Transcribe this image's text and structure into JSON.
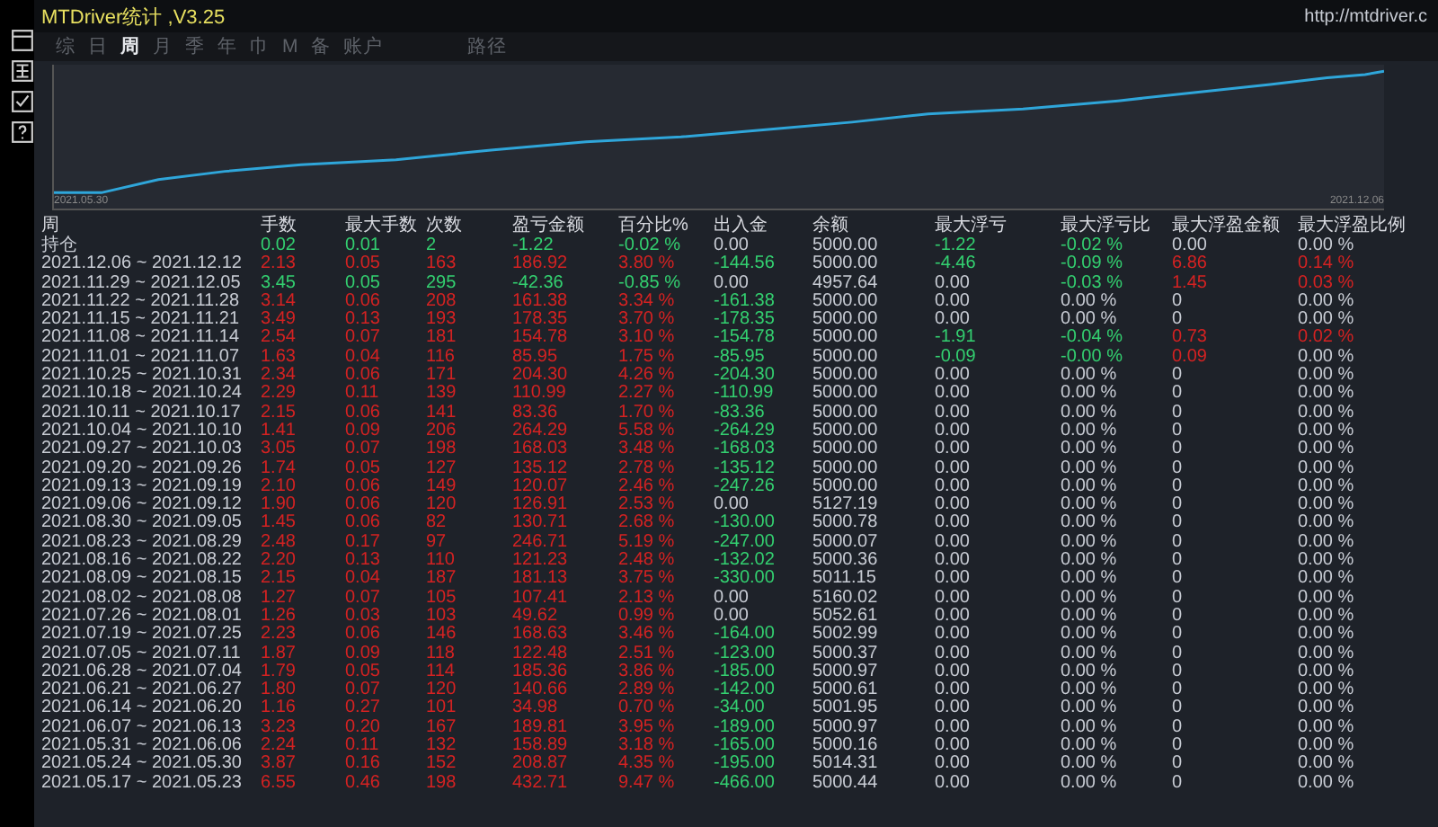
{
  "window": {
    "title": "MTDriver统计 ,V3.25",
    "url": "http://mtdriver.c"
  },
  "tabs": [
    {
      "label": "综",
      "selected": false
    },
    {
      "label": "日",
      "selected": false
    },
    {
      "label": "周",
      "selected": true
    },
    {
      "label": "月",
      "selected": false
    },
    {
      "label": "季",
      "selected": false
    },
    {
      "label": "年",
      "selected": false
    },
    {
      "label": "巾",
      "selected": false
    },
    {
      "label": "M",
      "selected": false
    },
    {
      "label": "备",
      "selected": false
    },
    {
      "label": "账户",
      "selected": false
    },
    {
      "label": "路径",
      "selected": false
    }
  ],
  "chart": {
    "start_label": "2021.05.30",
    "end_label": "2021.12.06"
  },
  "table": {
    "columns": [
      "周",
      "手数",
      "最大手数",
      "次数",
      "盈亏金额",
      "百分比%",
      "出入金",
      "余额",
      "最大浮亏",
      "最大浮亏比",
      "最大浮盈金额",
      "最大浮盈比例"
    ],
    "rows": [
      {
        "cells": [
          {
            "text": "持仓",
            "color": "#c8ccd4"
          },
          {
            "text": "0.02",
            "color": "#33d070"
          },
          {
            "text": "0.01",
            "color": "#33d070"
          },
          {
            "text": "2",
            "color": "#33d070"
          },
          {
            "text": "-1.22",
            "color": "#33d070"
          },
          {
            "text": "-0.02 %",
            "color": "#33d070"
          },
          {
            "text": "0.00",
            "color": "#c8ccd4"
          },
          {
            "text": "5000.00",
            "color": "#c8ccd4"
          },
          {
            "text": "-1.22",
            "color": "#33d070"
          },
          {
            "text": "-0.02 %",
            "color": "#33d070"
          },
          {
            "text": "0.00",
            "color": "#c8ccd4"
          },
          {
            "text": "0.00 %",
            "color": "#c8ccd4"
          }
        ]
      },
      {
        "cells": [
          {
            "text": "2021.12.06 ~ 2021.12.12",
            "color": "#c8ccd4"
          },
          {
            "text": "2.13",
            "color": "#d42222"
          },
          {
            "text": "0.05",
            "color": "#d42222"
          },
          {
            "text": "163",
            "color": "#d42222"
          },
          {
            "text": "186.92",
            "color": "#d42222"
          },
          {
            "text": "3.80 %",
            "color": "#d42222"
          },
          {
            "text": "-144.56",
            "color": "#33d070"
          },
          {
            "text": "5000.00",
            "color": "#c8ccd4"
          },
          {
            "text": "-4.46",
            "color": "#33d070"
          },
          {
            "text": "-0.09 %",
            "color": "#33d070"
          },
          {
            "text": "6.86",
            "color": "#d42222"
          },
          {
            "text": "0.14 %",
            "color": "#d42222"
          }
        ]
      },
      {
        "cells": [
          {
            "text": "2021.11.29 ~ 2021.12.05",
            "color": "#c8ccd4"
          },
          {
            "text": "3.45",
            "color": "#33d070"
          },
          {
            "text": "0.05",
            "color": "#33d070"
          },
          {
            "text": "295",
            "color": "#33d070"
          },
          {
            "text": "-42.36",
            "color": "#33d070"
          },
          {
            "text": "-0.85 %",
            "color": "#33d070"
          },
          {
            "text": "0.00",
            "color": "#c8ccd4"
          },
          {
            "text": "4957.64",
            "color": "#c8ccd4"
          },
          {
            "text": "0.00",
            "color": "#c8ccd4"
          },
          {
            "text": "-0.03 %",
            "color": "#33d070"
          },
          {
            "text": "1.45",
            "color": "#d42222"
          },
          {
            "text": "0.03 %",
            "color": "#d42222"
          }
        ]
      },
      {
        "cells": [
          {
            "text": "2021.11.22 ~ 2021.11.28",
            "color": "#c8ccd4"
          },
          {
            "text": "3.14",
            "color": "#d42222"
          },
          {
            "text": "0.06",
            "color": "#d42222"
          },
          {
            "text": "208",
            "color": "#d42222"
          },
          {
            "text": "161.38",
            "color": "#d42222"
          },
          {
            "text": "3.34 %",
            "color": "#d42222"
          },
          {
            "text": "-161.38",
            "color": "#33d070"
          },
          {
            "text": "5000.00",
            "color": "#c8ccd4"
          },
          {
            "text": "0.00",
            "color": "#c8ccd4"
          },
          {
            "text": "0.00 %",
            "color": "#c8ccd4"
          },
          {
            "text": "0",
            "color": "#c8ccd4"
          },
          {
            "text": "0.00 %",
            "color": "#c8ccd4"
          }
        ]
      },
      {
        "cells": [
          {
            "text": "2021.11.15 ~ 2021.11.21",
            "color": "#c8ccd4"
          },
          {
            "text": "3.49",
            "color": "#d42222"
          },
          {
            "text": "0.13",
            "color": "#d42222"
          },
          {
            "text": "193",
            "color": "#d42222"
          },
          {
            "text": "178.35",
            "color": "#d42222"
          },
          {
            "text": "3.70 %",
            "color": "#d42222"
          },
          {
            "text": "-178.35",
            "color": "#33d070"
          },
          {
            "text": "5000.00",
            "color": "#c8ccd4"
          },
          {
            "text": "0.00",
            "color": "#c8ccd4"
          },
          {
            "text": "0.00 %",
            "color": "#c8ccd4"
          },
          {
            "text": "0",
            "color": "#c8ccd4"
          },
          {
            "text": "0.00 %",
            "color": "#c8ccd4"
          }
        ]
      },
      {
        "cells": [
          {
            "text": "2021.11.08 ~ 2021.11.14",
            "color": "#c8ccd4"
          },
          {
            "text": "2.54",
            "color": "#d42222"
          },
          {
            "text": "0.07",
            "color": "#d42222"
          },
          {
            "text": "181",
            "color": "#d42222"
          },
          {
            "text": "154.78",
            "color": "#d42222"
          },
          {
            "text": "3.10 %",
            "color": "#d42222"
          },
          {
            "text": "-154.78",
            "color": "#33d070"
          },
          {
            "text": "5000.00",
            "color": "#c8ccd4"
          },
          {
            "text": "-1.91",
            "color": "#33d070"
          },
          {
            "text": "-0.04 %",
            "color": "#33d070"
          },
          {
            "text": "0.73",
            "color": "#d42222"
          },
          {
            "text": "0.02 %",
            "color": "#d42222"
          }
        ]
      },
      {
        "cells": [
          {
            "text": "2021.11.01 ~ 2021.11.07",
            "color": "#c8ccd4"
          },
          {
            "text": "1.63",
            "color": "#d42222"
          },
          {
            "text": "0.04",
            "color": "#d42222"
          },
          {
            "text": "116",
            "color": "#d42222"
          },
          {
            "text": "85.95",
            "color": "#d42222"
          },
          {
            "text": "1.75 %",
            "color": "#d42222"
          },
          {
            "text": "-85.95",
            "color": "#33d070"
          },
          {
            "text": "5000.00",
            "color": "#c8ccd4"
          },
          {
            "text": "-0.09",
            "color": "#33d070"
          },
          {
            "text": "-0.00 %",
            "color": "#33d070"
          },
          {
            "text": "0.09",
            "color": "#d42222"
          },
          {
            "text": "0.00 %",
            "color": "#c8ccd4"
          }
        ]
      },
      {
        "cells": [
          {
            "text": "2021.10.25 ~ 2021.10.31",
            "color": "#c8ccd4"
          },
          {
            "text": "2.34",
            "color": "#d42222"
          },
          {
            "text": "0.06",
            "color": "#d42222"
          },
          {
            "text": "171",
            "color": "#d42222"
          },
          {
            "text": "204.30",
            "color": "#d42222"
          },
          {
            "text": "4.26 %",
            "color": "#d42222"
          },
          {
            "text": "-204.30",
            "color": "#33d070"
          },
          {
            "text": "5000.00",
            "color": "#c8ccd4"
          },
          {
            "text": "0.00",
            "color": "#c8ccd4"
          },
          {
            "text": "0.00 %",
            "color": "#c8ccd4"
          },
          {
            "text": "0",
            "color": "#c8ccd4"
          },
          {
            "text": "0.00 %",
            "color": "#c8ccd4"
          }
        ]
      },
      {
        "cells": [
          {
            "text": "2021.10.18 ~ 2021.10.24",
            "color": "#c8ccd4"
          },
          {
            "text": "2.29",
            "color": "#d42222"
          },
          {
            "text": "0.11",
            "color": "#d42222"
          },
          {
            "text": "139",
            "color": "#d42222"
          },
          {
            "text": "110.99",
            "color": "#d42222"
          },
          {
            "text": "2.27 %",
            "color": "#d42222"
          },
          {
            "text": "-110.99",
            "color": "#33d070"
          },
          {
            "text": "5000.00",
            "color": "#c8ccd4"
          },
          {
            "text": "0.00",
            "color": "#c8ccd4"
          },
          {
            "text": "0.00 %",
            "color": "#c8ccd4"
          },
          {
            "text": "0",
            "color": "#c8ccd4"
          },
          {
            "text": "0.00 %",
            "color": "#c8ccd4"
          }
        ]
      },
      {
        "cells": [
          {
            "text": "2021.10.11 ~ 2021.10.17",
            "color": "#c8ccd4"
          },
          {
            "text": "2.15",
            "color": "#d42222"
          },
          {
            "text": "0.06",
            "color": "#d42222"
          },
          {
            "text": "141",
            "color": "#d42222"
          },
          {
            "text": "83.36",
            "color": "#d42222"
          },
          {
            "text": "1.70 %",
            "color": "#d42222"
          },
          {
            "text": "-83.36",
            "color": "#33d070"
          },
          {
            "text": "5000.00",
            "color": "#c8ccd4"
          },
          {
            "text": "0.00",
            "color": "#c8ccd4"
          },
          {
            "text": "0.00 %",
            "color": "#c8ccd4"
          },
          {
            "text": "0",
            "color": "#c8ccd4"
          },
          {
            "text": "0.00 %",
            "color": "#c8ccd4"
          }
        ]
      },
      {
        "cells": [
          {
            "text": "2021.10.04 ~ 2021.10.10",
            "color": "#c8ccd4"
          },
          {
            "text": "1.41",
            "color": "#d42222"
          },
          {
            "text": "0.09",
            "color": "#d42222"
          },
          {
            "text": "206",
            "color": "#d42222"
          },
          {
            "text": "264.29",
            "color": "#d42222"
          },
          {
            "text": "5.58 %",
            "color": "#d42222"
          },
          {
            "text": "-264.29",
            "color": "#33d070"
          },
          {
            "text": "5000.00",
            "color": "#c8ccd4"
          },
          {
            "text": "0.00",
            "color": "#c8ccd4"
          },
          {
            "text": "0.00 %",
            "color": "#c8ccd4"
          },
          {
            "text": "0",
            "color": "#c8ccd4"
          },
          {
            "text": "0.00 %",
            "color": "#c8ccd4"
          }
        ]
      },
      {
        "cells": [
          {
            "text": "2021.09.27 ~ 2021.10.03",
            "color": "#c8ccd4"
          },
          {
            "text": "3.05",
            "color": "#d42222"
          },
          {
            "text": "0.07",
            "color": "#d42222"
          },
          {
            "text": "198",
            "color": "#d42222"
          },
          {
            "text": "168.03",
            "color": "#d42222"
          },
          {
            "text": "3.48 %",
            "color": "#d42222"
          },
          {
            "text": "-168.03",
            "color": "#33d070"
          },
          {
            "text": "5000.00",
            "color": "#c8ccd4"
          },
          {
            "text": "0.00",
            "color": "#c8ccd4"
          },
          {
            "text": "0.00 %",
            "color": "#c8ccd4"
          },
          {
            "text": "0",
            "color": "#c8ccd4"
          },
          {
            "text": "0.00 %",
            "color": "#c8ccd4"
          }
        ]
      },
      {
        "cells": [
          {
            "text": "2021.09.20 ~ 2021.09.26",
            "color": "#c8ccd4"
          },
          {
            "text": "1.74",
            "color": "#d42222"
          },
          {
            "text": "0.05",
            "color": "#d42222"
          },
          {
            "text": "127",
            "color": "#d42222"
          },
          {
            "text": "135.12",
            "color": "#d42222"
          },
          {
            "text": "2.78 %",
            "color": "#d42222"
          },
          {
            "text": "-135.12",
            "color": "#33d070"
          },
          {
            "text": "5000.00",
            "color": "#c8ccd4"
          },
          {
            "text": "0.00",
            "color": "#c8ccd4"
          },
          {
            "text": "0.00 %",
            "color": "#c8ccd4"
          },
          {
            "text": "0",
            "color": "#c8ccd4"
          },
          {
            "text": "0.00 %",
            "color": "#c8ccd4"
          }
        ]
      },
      {
        "cells": [
          {
            "text": "2021.09.13 ~ 2021.09.19",
            "color": "#c8ccd4"
          },
          {
            "text": "2.10",
            "color": "#d42222"
          },
          {
            "text": "0.06",
            "color": "#d42222"
          },
          {
            "text": "149",
            "color": "#d42222"
          },
          {
            "text": "120.07",
            "color": "#d42222"
          },
          {
            "text": "2.46 %",
            "color": "#d42222"
          },
          {
            "text": "-247.26",
            "color": "#33d070"
          },
          {
            "text": "5000.00",
            "color": "#c8ccd4"
          },
          {
            "text": "0.00",
            "color": "#c8ccd4"
          },
          {
            "text": "0.00 %",
            "color": "#c8ccd4"
          },
          {
            "text": "0",
            "color": "#c8ccd4"
          },
          {
            "text": "0.00 %",
            "color": "#c8ccd4"
          }
        ]
      },
      {
        "cells": [
          {
            "text": "2021.09.06 ~ 2021.09.12",
            "color": "#c8ccd4"
          },
          {
            "text": "1.90",
            "color": "#d42222"
          },
          {
            "text": "0.06",
            "color": "#d42222"
          },
          {
            "text": "120",
            "color": "#d42222"
          },
          {
            "text": "126.91",
            "color": "#d42222"
          },
          {
            "text": "2.53 %",
            "color": "#d42222"
          },
          {
            "text": "0.00",
            "color": "#c8ccd4"
          },
          {
            "text": "5127.19",
            "color": "#c8ccd4"
          },
          {
            "text": "0.00",
            "color": "#c8ccd4"
          },
          {
            "text": "0.00 %",
            "color": "#c8ccd4"
          },
          {
            "text": "0",
            "color": "#c8ccd4"
          },
          {
            "text": "0.00 %",
            "color": "#c8ccd4"
          }
        ]
      },
      {
        "cells": [
          {
            "text": "2021.08.30 ~ 2021.09.05",
            "color": "#c8ccd4"
          },
          {
            "text": "1.45",
            "color": "#d42222"
          },
          {
            "text": "0.06",
            "color": "#d42222"
          },
          {
            "text": "82",
            "color": "#d42222"
          },
          {
            "text": "130.71",
            "color": "#d42222"
          },
          {
            "text": "2.68 %",
            "color": "#d42222"
          },
          {
            "text": "-130.00",
            "color": "#33d070"
          },
          {
            "text": "5000.78",
            "color": "#c8ccd4"
          },
          {
            "text": "0.00",
            "color": "#c8ccd4"
          },
          {
            "text": "0.00 %",
            "color": "#c8ccd4"
          },
          {
            "text": "0",
            "color": "#c8ccd4"
          },
          {
            "text": "0.00 %",
            "color": "#c8ccd4"
          }
        ]
      },
      {
        "cells": [
          {
            "text": "2021.08.23 ~ 2021.08.29",
            "color": "#c8ccd4"
          },
          {
            "text": "2.48",
            "color": "#d42222"
          },
          {
            "text": "0.17",
            "color": "#d42222"
          },
          {
            "text": "97",
            "color": "#d42222"
          },
          {
            "text": "246.71",
            "color": "#d42222"
          },
          {
            "text": "5.19 %",
            "color": "#d42222"
          },
          {
            "text": "-247.00",
            "color": "#33d070"
          },
          {
            "text": "5000.07",
            "color": "#c8ccd4"
          },
          {
            "text": "0.00",
            "color": "#c8ccd4"
          },
          {
            "text": "0.00 %",
            "color": "#c8ccd4"
          },
          {
            "text": "0",
            "color": "#c8ccd4"
          },
          {
            "text": "0.00 %",
            "color": "#c8ccd4"
          }
        ]
      },
      {
        "cells": [
          {
            "text": "2021.08.16 ~ 2021.08.22",
            "color": "#c8ccd4"
          },
          {
            "text": "2.20",
            "color": "#d42222"
          },
          {
            "text": "0.13",
            "color": "#d42222"
          },
          {
            "text": "110",
            "color": "#d42222"
          },
          {
            "text": "121.23",
            "color": "#d42222"
          },
          {
            "text": "2.48 %",
            "color": "#d42222"
          },
          {
            "text": "-132.02",
            "color": "#33d070"
          },
          {
            "text": "5000.36",
            "color": "#c8ccd4"
          },
          {
            "text": "0.00",
            "color": "#c8ccd4"
          },
          {
            "text": "0.00 %",
            "color": "#c8ccd4"
          },
          {
            "text": "0",
            "color": "#c8ccd4"
          },
          {
            "text": "0.00 %",
            "color": "#c8ccd4"
          }
        ]
      },
      {
        "cells": [
          {
            "text": "2021.08.09 ~ 2021.08.15",
            "color": "#c8ccd4"
          },
          {
            "text": "2.15",
            "color": "#d42222"
          },
          {
            "text": "0.04",
            "color": "#d42222"
          },
          {
            "text": "187",
            "color": "#d42222"
          },
          {
            "text": "181.13",
            "color": "#d42222"
          },
          {
            "text": "3.75 %",
            "color": "#d42222"
          },
          {
            "text": "-330.00",
            "color": "#33d070"
          },
          {
            "text": "5011.15",
            "color": "#c8ccd4"
          },
          {
            "text": "0.00",
            "color": "#c8ccd4"
          },
          {
            "text": "0.00 %",
            "color": "#c8ccd4"
          },
          {
            "text": "0",
            "color": "#c8ccd4"
          },
          {
            "text": "0.00 %",
            "color": "#c8ccd4"
          }
        ]
      },
      {
        "cells": [
          {
            "text": "2021.08.02 ~ 2021.08.08",
            "color": "#c8ccd4"
          },
          {
            "text": "1.27",
            "color": "#d42222"
          },
          {
            "text": "0.07",
            "color": "#d42222"
          },
          {
            "text": "105",
            "color": "#d42222"
          },
          {
            "text": "107.41",
            "color": "#d42222"
          },
          {
            "text": "2.13 %",
            "color": "#d42222"
          },
          {
            "text": "0.00",
            "color": "#c8ccd4"
          },
          {
            "text": "5160.02",
            "color": "#c8ccd4"
          },
          {
            "text": "0.00",
            "color": "#c8ccd4"
          },
          {
            "text": "0.00 %",
            "color": "#c8ccd4"
          },
          {
            "text": "0",
            "color": "#c8ccd4"
          },
          {
            "text": "0.00 %",
            "color": "#c8ccd4"
          }
        ]
      },
      {
        "cells": [
          {
            "text": "2021.07.26 ~ 2021.08.01",
            "color": "#c8ccd4"
          },
          {
            "text": "1.26",
            "color": "#d42222"
          },
          {
            "text": "0.03",
            "color": "#d42222"
          },
          {
            "text": "103",
            "color": "#d42222"
          },
          {
            "text": "49.62",
            "color": "#d42222"
          },
          {
            "text": "0.99 %",
            "color": "#d42222"
          },
          {
            "text": "0.00",
            "color": "#c8ccd4"
          },
          {
            "text": "5052.61",
            "color": "#c8ccd4"
          },
          {
            "text": "0.00",
            "color": "#c8ccd4"
          },
          {
            "text": "0.00 %",
            "color": "#c8ccd4"
          },
          {
            "text": "0",
            "color": "#c8ccd4"
          },
          {
            "text": "0.00 %",
            "color": "#c8ccd4"
          }
        ]
      },
      {
        "cells": [
          {
            "text": "2021.07.19 ~ 2021.07.25",
            "color": "#c8ccd4"
          },
          {
            "text": "2.23",
            "color": "#d42222"
          },
          {
            "text": "0.06",
            "color": "#d42222"
          },
          {
            "text": "146",
            "color": "#d42222"
          },
          {
            "text": "168.63",
            "color": "#d42222"
          },
          {
            "text": "3.46 %",
            "color": "#d42222"
          },
          {
            "text": "-164.00",
            "color": "#33d070"
          },
          {
            "text": "5002.99",
            "color": "#c8ccd4"
          },
          {
            "text": "0.00",
            "color": "#c8ccd4"
          },
          {
            "text": "0.00 %",
            "color": "#c8ccd4"
          },
          {
            "text": "0",
            "color": "#c8ccd4"
          },
          {
            "text": "0.00 %",
            "color": "#c8ccd4"
          }
        ]
      },
      {
        "cells": [
          {
            "text": "2021.07.05 ~ 2021.07.11",
            "color": "#c8ccd4"
          },
          {
            "text": "1.87",
            "color": "#d42222"
          },
          {
            "text": "0.09",
            "color": "#d42222"
          },
          {
            "text": "118",
            "color": "#d42222"
          },
          {
            "text": "122.48",
            "color": "#d42222"
          },
          {
            "text": "2.51 %",
            "color": "#d42222"
          },
          {
            "text": "-123.00",
            "color": "#33d070"
          },
          {
            "text": "5000.37",
            "color": "#c8ccd4"
          },
          {
            "text": "0.00",
            "color": "#c8ccd4"
          },
          {
            "text": "0.00 %",
            "color": "#c8ccd4"
          },
          {
            "text": "0",
            "color": "#c8ccd4"
          },
          {
            "text": "0.00 %",
            "color": "#c8ccd4"
          }
        ]
      },
      {
        "cells": [
          {
            "text": "2021.06.28 ~ 2021.07.04",
            "color": "#c8ccd4"
          },
          {
            "text": "1.79",
            "color": "#d42222"
          },
          {
            "text": "0.05",
            "color": "#d42222"
          },
          {
            "text": "114",
            "color": "#d42222"
          },
          {
            "text": "185.36",
            "color": "#d42222"
          },
          {
            "text": "3.86 %",
            "color": "#d42222"
          },
          {
            "text": "-185.00",
            "color": "#33d070"
          },
          {
            "text": "5000.97",
            "color": "#c8ccd4"
          },
          {
            "text": "0.00",
            "color": "#c8ccd4"
          },
          {
            "text": "0.00 %",
            "color": "#c8ccd4"
          },
          {
            "text": "0",
            "color": "#c8ccd4"
          },
          {
            "text": "0.00 %",
            "color": "#c8ccd4"
          }
        ]
      },
      {
        "cells": [
          {
            "text": "2021.06.21 ~ 2021.06.27",
            "color": "#c8ccd4"
          },
          {
            "text": "1.80",
            "color": "#d42222"
          },
          {
            "text": "0.07",
            "color": "#d42222"
          },
          {
            "text": "120",
            "color": "#d42222"
          },
          {
            "text": "140.66",
            "color": "#d42222"
          },
          {
            "text": "2.89 %",
            "color": "#d42222"
          },
          {
            "text": "-142.00",
            "color": "#33d070"
          },
          {
            "text": "5000.61",
            "color": "#c8ccd4"
          },
          {
            "text": "0.00",
            "color": "#c8ccd4"
          },
          {
            "text": "0.00 %",
            "color": "#c8ccd4"
          },
          {
            "text": "0",
            "color": "#c8ccd4"
          },
          {
            "text": "0.00 %",
            "color": "#c8ccd4"
          }
        ]
      },
      {
        "cells": [
          {
            "text": "2021.06.14 ~ 2021.06.20",
            "color": "#c8ccd4"
          },
          {
            "text": "1.16",
            "color": "#d42222"
          },
          {
            "text": "0.27",
            "color": "#d42222"
          },
          {
            "text": "101",
            "color": "#d42222"
          },
          {
            "text": "34.98",
            "color": "#d42222"
          },
          {
            "text": "0.70 %",
            "color": "#d42222"
          },
          {
            "text": "-34.00",
            "color": "#33d070"
          },
          {
            "text": "5001.95",
            "color": "#c8ccd4"
          },
          {
            "text": "0.00",
            "color": "#c8ccd4"
          },
          {
            "text": "0.00 %",
            "color": "#c8ccd4"
          },
          {
            "text": "0",
            "color": "#c8ccd4"
          },
          {
            "text": "0.00 %",
            "color": "#c8ccd4"
          }
        ]
      },
      {
        "cells": [
          {
            "text": "2021.06.07 ~ 2021.06.13",
            "color": "#c8ccd4"
          },
          {
            "text": "3.23",
            "color": "#d42222"
          },
          {
            "text": "0.20",
            "color": "#d42222"
          },
          {
            "text": "167",
            "color": "#d42222"
          },
          {
            "text": "189.81",
            "color": "#d42222"
          },
          {
            "text": "3.95 %",
            "color": "#d42222"
          },
          {
            "text": "-189.00",
            "color": "#33d070"
          },
          {
            "text": "5000.97",
            "color": "#c8ccd4"
          },
          {
            "text": "0.00",
            "color": "#c8ccd4"
          },
          {
            "text": "0.00 %",
            "color": "#c8ccd4"
          },
          {
            "text": "0",
            "color": "#c8ccd4"
          },
          {
            "text": "0.00 %",
            "color": "#c8ccd4"
          }
        ]
      },
      {
        "cells": [
          {
            "text": "2021.05.31 ~ 2021.06.06",
            "color": "#c8ccd4"
          },
          {
            "text": "2.24",
            "color": "#d42222"
          },
          {
            "text": "0.11",
            "color": "#d42222"
          },
          {
            "text": "132",
            "color": "#d42222"
          },
          {
            "text": "158.89",
            "color": "#d42222"
          },
          {
            "text": "3.18 %",
            "color": "#d42222"
          },
          {
            "text": "-165.00",
            "color": "#33d070"
          },
          {
            "text": "5000.16",
            "color": "#c8ccd4"
          },
          {
            "text": "0.00",
            "color": "#c8ccd4"
          },
          {
            "text": "0.00 %",
            "color": "#c8ccd4"
          },
          {
            "text": "0",
            "color": "#c8ccd4"
          },
          {
            "text": "0.00 %",
            "color": "#c8ccd4"
          }
        ]
      },
      {
        "cells": [
          {
            "text": "2021.05.24 ~ 2021.05.30",
            "color": "#c8ccd4"
          },
          {
            "text": "3.87",
            "color": "#d42222"
          },
          {
            "text": "0.16",
            "color": "#d42222"
          },
          {
            "text": "152",
            "color": "#d42222"
          },
          {
            "text": "208.87",
            "color": "#d42222"
          },
          {
            "text": "4.35 %",
            "color": "#d42222"
          },
          {
            "text": "-195.00",
            "color": "#33d070"
          },
          {
            "text": "5014.31",
            "color": "#c8ccd4"
          },
          {
            "text": "0.00",
            "color": "#c8ccd4"
          },
          {
            "text": "0.00 %",
            "color": "#c8ccd4"
          },
          {
            "text": "0",
            "color": "#c8ccd4"
          },
          {
            "text": "0.00 %",
            "color": "#c8ccd4"
          }
        ]
      },
      {
        "cells": [
          {
            "text": "2021.05.17 ~ 2021.05.23",
            "color": "#c8ccd4"
          },
          {
            "text": "6.55",
            "color": "#d42222"
          },
          {
            "text": "0.46",
            "color": "#d42222"
          },
          {
            "text": "198",
            "color": "#d42222"
          },
          {
            "text": "432.71",
            "color": "#d42222"
          },
          {
            "text": "9.47 %",
            "color": "#d42222"
          },
          {
            "text": "-466.00",
            "color": "#33d070"
          },
          {
            "text": "5000.44",
            "color": "#c8ccd4"
          },
          {
            "text": "0.00",
            "color": "#c8ccd4"
          },
          {
            "text": "0.00 %",
            "color": "#c8ccd4"
          },
          {
            "text": "0",
            "color": "#c8ccd4"
          },
          {
            "text": "0.00 %",
            "color": "#c8ccd4"
          }
        ]
      }
    ]
  }
}
